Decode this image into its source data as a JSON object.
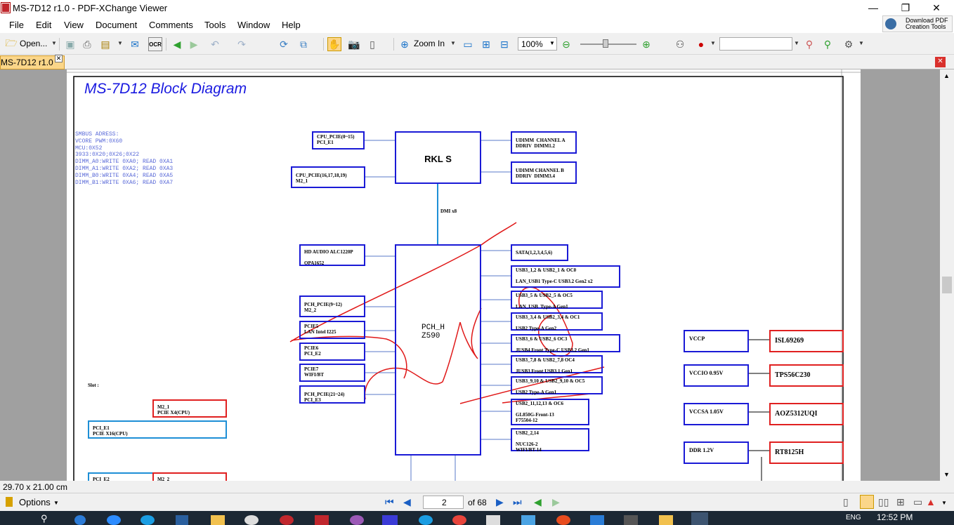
{
  "window": {
    "title": "MS-7D12 r1.0 - PDF-XChange Viewer",
    "minimize": "—",
    "maximize": "❐",
    "close": "✕"
  },
  "menu": [
    "File",
    "Edit",
    "View",
    "Document",
    "Comments",
    "Tools",
    "Window",
    "Help"
  ],
  "toolbar": {
    "open_label": "Open...",
    "zoom_in_label": "Zoom In",
    "zoom_value": "100%",
    "download_line1": "Download PDF",
    "download_line2": "Creation Tools"
  },
  "tab": {
    "label": "MS-7D12 r1.0"
  },
  "diagram": {
    "title": "MS-7D12 Block Diagram",
    "smbus": [
      "SMBUS ADRESS:",
      "VCORE PWM:0X60",
      "MCU:0X52",
      "3933:0X20;0X26;0X22",
      "DIMM_A0:WRITE 0XA0; READ 0XA1",
      "DIMM_A1:WRITE 0XA2; READ 0XA3",
      "DIMM_B0:WRITE 0XA4; READ 0XA5",
      "DIMM_B1:WRITE 0XA6; READ 0XA7"
    ],
    "cpu": "RKL S",
    "pch_line1": "PCH_H",
    "pch_line2": "Z590",
    "dmi": "DMI  x8",
    "slot": "Slot :",
    "boxes": {
      "cpu_pcie1": "CPU_PCIE(0~15)\nPCI_E1",
      "cpu_pcie2": "CPU_PCIE(16,17,18,19)\nM2_1",
      "dimm_a": "UDIMM  CHANNEL A\nDDRIV  DIMM1.2",
      "dimm_b": "UDIMM CHANNEL B\nDDRIV  DIMM3.4",
      "audio": "HD AUDIO ALC1220P\n\nOPA1652",
      "pch_pcie1": "PCH_PCIE(9~12)\nM2_2",
      "pcie5": "PCIE5\nLAN Intel I225",
      "pcie6": "PCIE6\nPCI_E2",
      "pcie7": "PCIE7\nWIFI/BT",
      "pch_pcie2": "PCH_PCIE(21~24)\nPCI_E3",
      "sata": "SATA(1,2,3,4,5,6)",
      "usb1": "USB3_1,2 & USB2_1 & OC0\n\nLAN_USB1 Type-C USB3.2 Gen2 x2",
      "usb2": "USB3_5 & USB2_5 & OC5\n\nLAN_USB  Type-A Gen1",
      "usb3": "USB3_3,4 & USB2_3,4 & OC1\n\nUSB2 Type-A Gen2",
      "usb4": "USB3_6 & USB2_6 OC3\n\nJUSB4 Front Type-C USB3.2 Gen1",
      "usb5": "USB3_7,8 & USB2_7,8 OC4\n\nJUSB3 Front USB3.1 Gen1",
      "usb6": "USB3_9,10 & USB2_9,10 & OC5\n\nUSB2 Type-A Gen1",
      "usb7": "USB2_11,12,13 & OC6\n\nGL850G-Front-13\nF75504-12",
      "usb8": "USB2_2,14\n\nNUC126-2\nWIFI/BT-14",
      "m2_1": "M2_1\nPCIE X4(CPU)",
      "pci_e1": "PCI_E1\nPCIE X16(CPU)",
      "pci_e2": "PCI_E2",
      "m2_2": "M2_2",
      "vccp": "VCCP",
      "vccio": "VCCIO 0.95V",
      "vccsa": "VCCSA 1.05V",
      "ddr": "DDR 1.2V",
      "isl": "ISL69269",
      "tps": "TPS56C230",
      "aoz": "AOZ5312UQI",
      "rt": "RT8125H"
    }
  },
  "status": {
    "page_size": "29.70 x 21.00 cm",
    "options": "Options"
  },
  "nav": {
    "current_page": "2",
    "of_pages": "of 68"
  },
  "taskbar": {
    "time": "12:52 PM",
    "lang": "ENG"
  }
}
